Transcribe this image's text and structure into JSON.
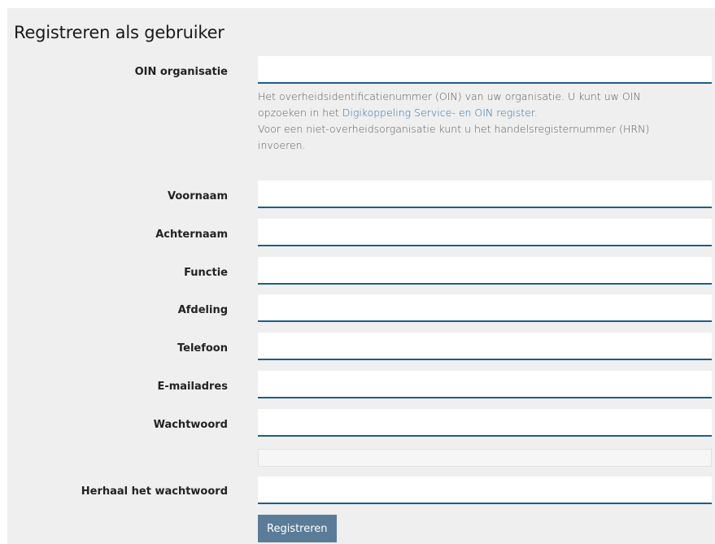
{
  "form": {
    "title": "Registreren als gebruiker",
    "oin": {
      "label": "OIN organisatie",
      "value": "",
      "help_line1": "Het overheidsidentificatienummer (OIN) van uw organisatie. U kunt uw OIN",
      "help_line2_prefix": "opzoeken in het ",
      "help_link": "Digikoppeling Service- en OIN register",
      "help_line2_suffix": ".",
      "help_line3": "Voor een niet-overheidsorganisatie kunt u het handelsregisternummer (HRN)",
      "help_line4": "invoeren."
    },
    "voornaam": {
      "label": "Voornaam",
      "value": ""
    },
    "achternaam": {
      "label": "Achternaam",
      "value": ""
    },
    "functie": {
      "label": "Functie",
      "value": ""
    },
    "afdeling": {
      "label": "Afdeling",
      "value": ""
    },
    "telefoon": {
      "label": "Telefoon",
      "value": ""
    },
    "email": {
      "label": "E-mailadres",
      "value": ""
    },
    "wachtwoord": {
      "label": "Wachtwoord",
      "value": ""
    },
    "herhaal": {
      "label": "Herhaal het wachtwoord",
      "value": ""
    },
    "submit_label": "Registreren"
  },
  "colors": {
    "panel_bg": "#efefef",
    "input_border": "#1f5d8b",
    "link": "#2a6fa9",
    "button_bg": "#5b7c98"
  }
}
